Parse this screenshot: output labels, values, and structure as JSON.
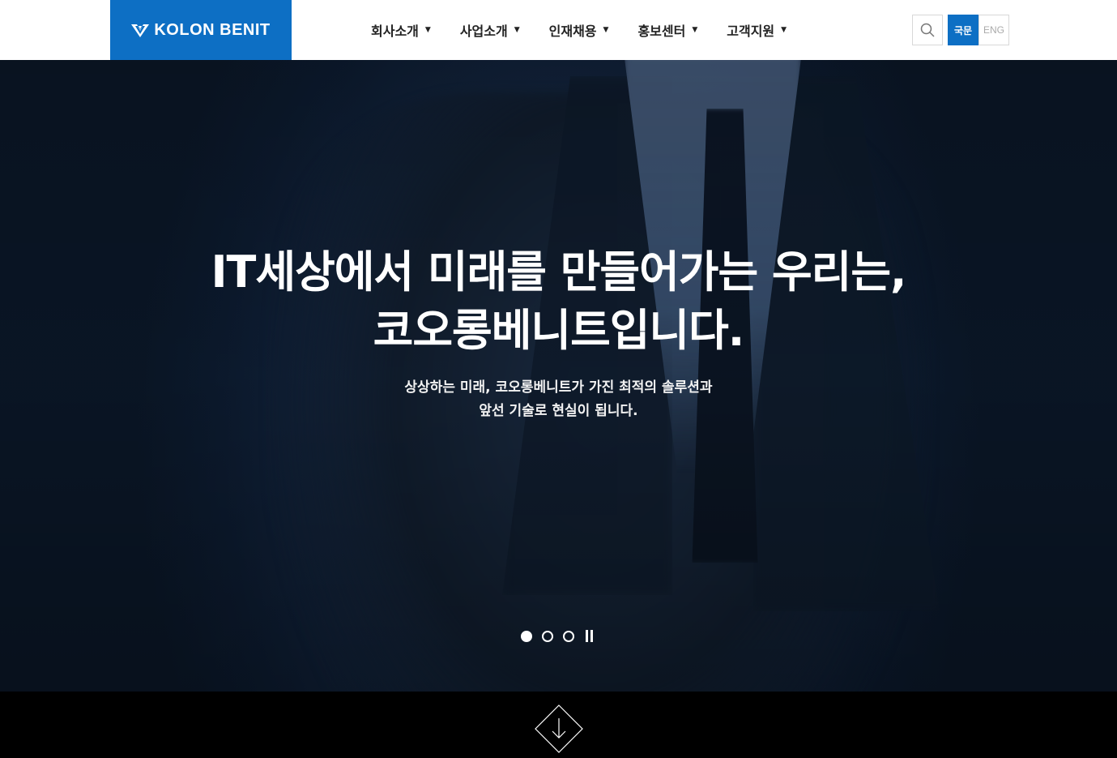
{
  "brand": {
    "name": "KOLON BENIT",
    "color": "#0d6fc4"
  },
  "nav": {
    "items": [
      {
        "label": "회사소개"
      },
      {
        "label": "사업소개"
      },
      {
        "label": "인재채용"
      },
      {
        "label": "홍보센터"
      },
      {
        "label": "고객지원"
      }
    ]
  },
  "utility": {
    "search_icon": "search-icon",
    "lang_ko": "국문",
    "lang_en": "ENG",
    "active_lang": "ko"
  },
  "hero": {
    "title_line1": "IT세상에서 미래를 만들어가는 우리는,",
    "title_line2": "코오롱베니트입니다.",
    "sub_line1": "상상하는 미래, 코오롱베니트가 가진 최적의 솔루션과",
    "sub_line2": "앞선 기술로 현실이 됩니다.",
    "slides_count": 3,
    "active_slide": 1
  },
  "scroll_down_icon": "arrow-down-diamond-icon"
}
